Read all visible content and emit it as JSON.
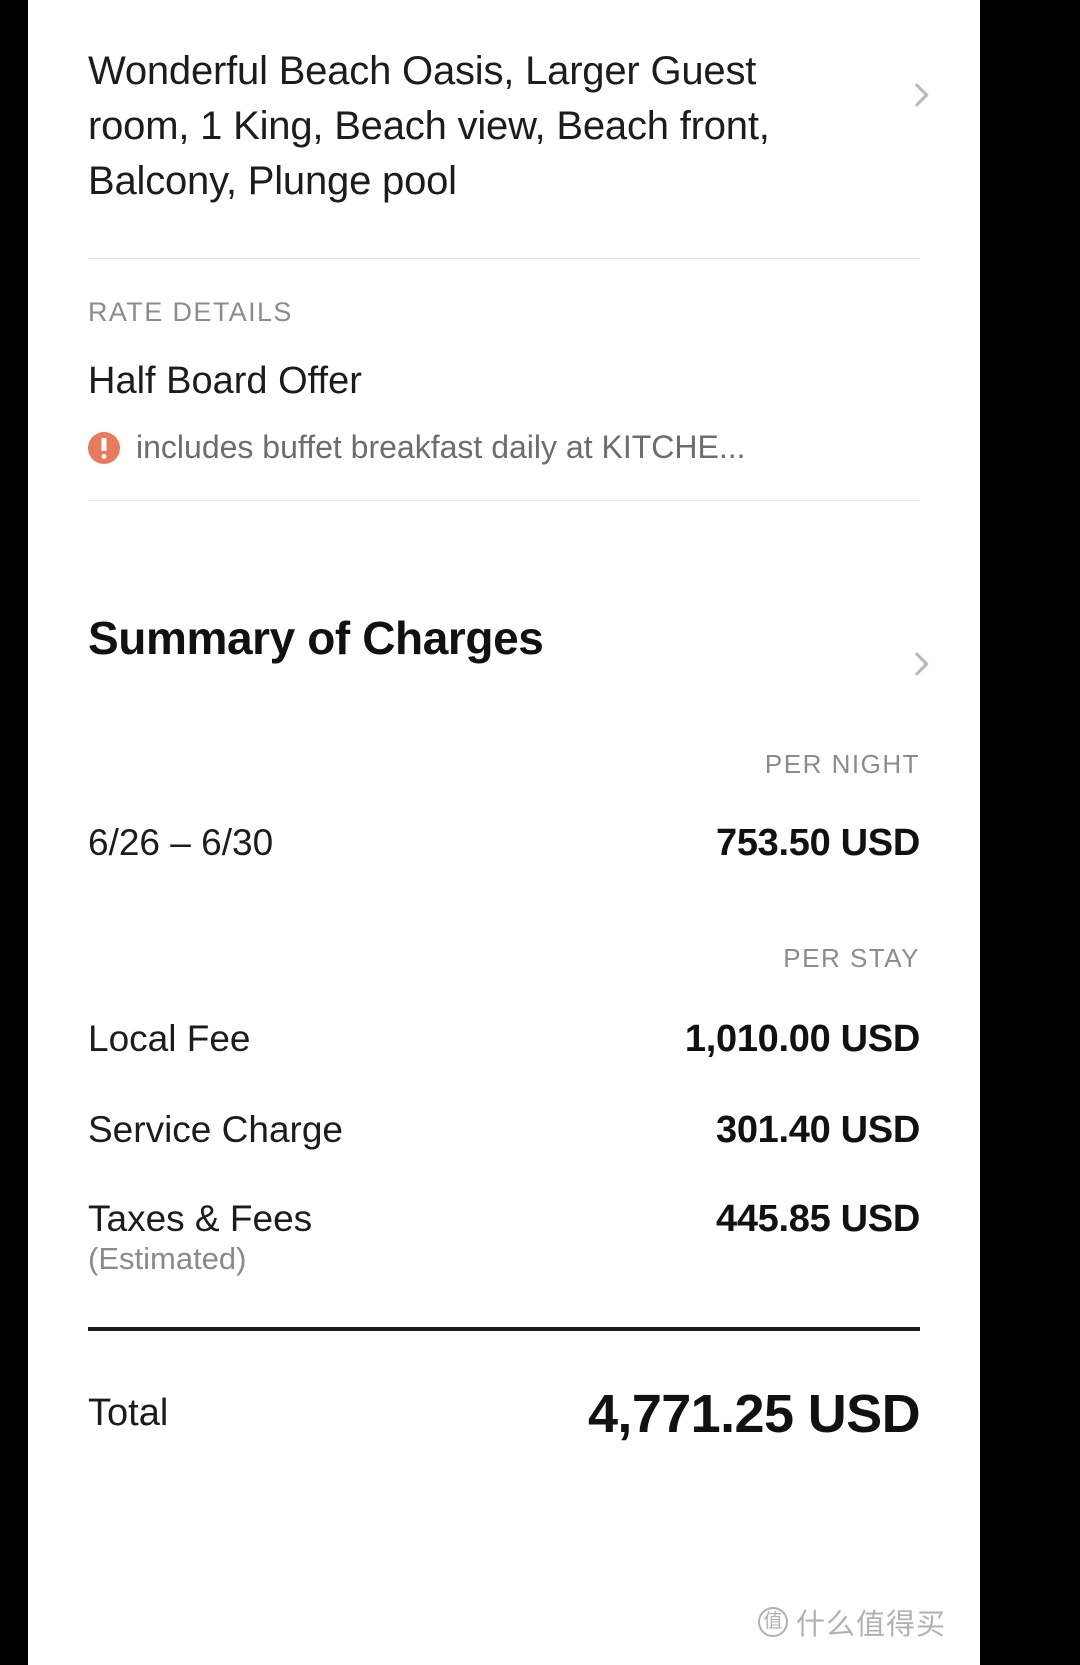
{
  "room": {
    "title": "Wonderful Beach Oasis, Larger Guest room, 1 King, Beach view, Beach front, Balcony, Plunge pool",
    "chevron_icon": "chevron-right-icon"
  },
  "rate_details": {
    "section_label": "RATE DETAILS",
    "offer_name": "Half Board Offer",
    "note_icon": "alert-circle-icon",
    "note_text": "includes buffet breakfast daily at KITCHE...",
    "chevron_icon": "chevron-right-icon",
    "accent_color": "#e87a5d"
  },
  "summary": {
    "title": "Summary of Charges",
    "per_night_header": "PER NIGHT",
    "per_stay_header": "PER STAY",
    "per_night": {
      "label": "6/26 – 6/30",
      "amount": "753.50 USD"
    },
    "per_stay_rows": [
      {
        "label": "Local Fee",
        "sub": "",
        "amount": "1,010.00 USD"
      },
      {
        "label": "Service Charge",
        "sub": "",
        "amount": "301.40 USD"
      },
      {
        "label": "Taxes & Fees",
        "sub": "(Estimated)",
        "amount": "445.85 USD"
      }
    ],
    "total_label": "Total",
    "total_amount": "4,771.25 USD"
  },
  "watermark": {
    "badge": "值",
    "text": "什么值得买"
  }
}
